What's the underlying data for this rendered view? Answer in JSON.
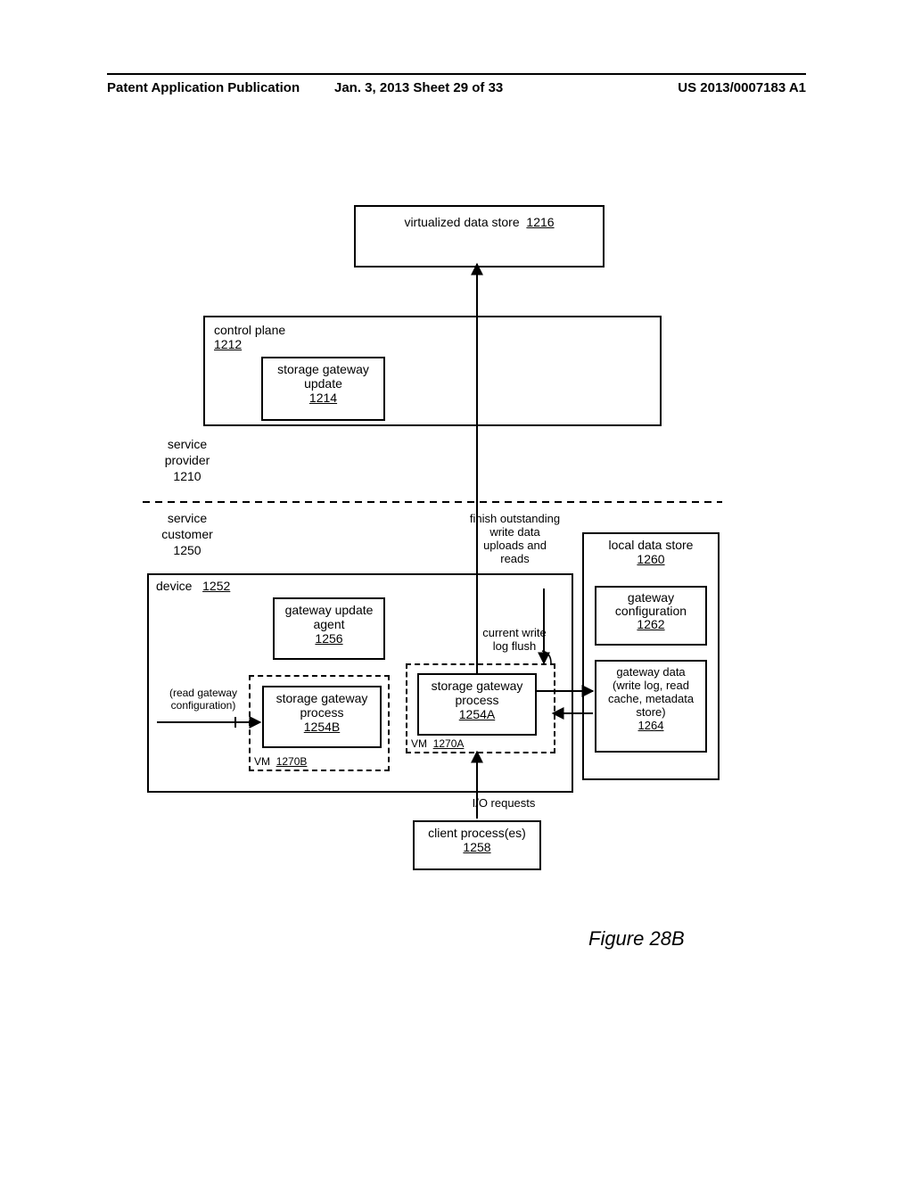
{
  "header": {
    "left": "Patent Application Publication",
    "mid": "Jan. 3, 2013  Sheet 29 of 33",
    "right": "US 2013/0007183 A1"
  },
  "boxes": {
    "vds_label": "virtualized data store",
    "vds_num": "1216",
    "cp_label": "control plane",
    "cp_num": "1212",
    "sgu_label1": "storage gateway",
    "sgu_label2": "update",
    "sgu_num": "1214",
    "gua_label1": "gateway update",
    "gua_label2": "agent",
    "gua_num": "1256",
    "sgp_b_label1": "storage gateway",
    "sgp_b_label2": "process",
    "sgp_b_num": "1254B",
    "sgp_a_label1": "storage gateway",
    "sgp_a_label2": "process",
    "sgp_a_num": "1254A",
    "vm_a_label": "VM",
    "vm_a_num": "1270A",
    "vm_b_label": "VM",
    "vm_b_num": "1270B",
    "device_label": "device",
    "device_num": "1252",
    "lds_label": "local data store",
    "lds_num": "1260",
    "gc_label1": "gateway",
    "gc_label2": "configuration",
    "gc_num": "1262",
    "gd_label1": "gateway data",
    "gd_label2": "(write log, read",
    "gd_label3": "cache, metadata",
    "gd_label4": "store)",
    "gd_num": "1264",
    "cp_proc_label": "client process(es)",
    "cp_proc_num": "1258"
  },
  "text": {
    "sp_label1": "service",
    "sp_label2": "provider",
    "sp_num": "1210",
    "sc_label1": "service",
    "sc_label2": "customer",
    "sc_num": "1250",
    "rgconf": "(read gateway",
    "rgconf2": "configuration)",
    "finish1": "finish outstanding",
    "finish2": "write data",
    "finish3": "uploads and",
    "finish4": "reads",
    "flush1": "current write",
    "flush2": "log flush",
    "ioreq": "I/O requests"
  },
  "figure": "Figure 28B"
}
